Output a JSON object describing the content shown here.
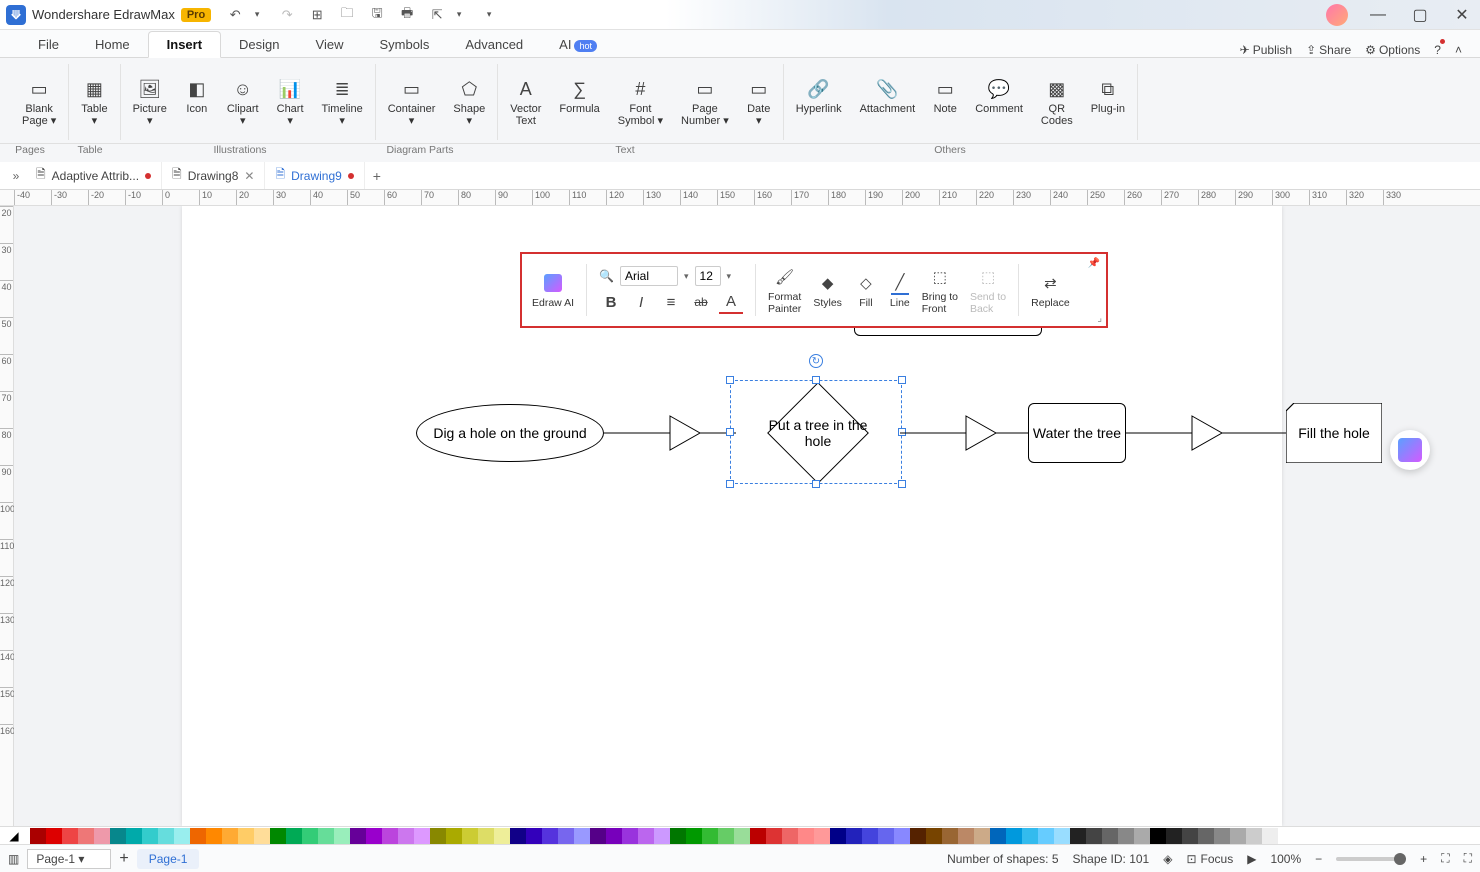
{
  "app": {
    "title": "Wondershare EdrawMax",
    "badge": "Pro"
  },
  "title_actions": [
    "undo",
    "redo",
    "new",
    "open",
    "save",
    "print",
    "export",
    "more"
  ],
  "menu": {
    "tabs": [
      "File",
      "Home",
      "Insert",
      "Design",
      "View",
      "Symbols",
      "Advanced",
      "AI"
    ],
    "active": "Insert",
    "ai_badge": "hot",
    "right": [
      {
        "icon": "↗",
        "label": "Publish"
      },
      {
        "icon": "↪",
        "label": "Share"
      },
      {
        "icon": "⚙",
        "label": "Options"
      },
      {
        "icon": "?",
        "label": ""
      },
      {
        "icon": "˄",
        "label": ""
      }
    ]
  },
  "ribbon": {
    "groups": [
      {
        "title": "Pages",
        "buttons": [
          {
            "icon": "▭",
            "label": "Blank\nPage ▾"
          }
        ]
      },
      {
        "title": "Table",
        "buttons": [
          {
            "icon": "▦",
            "label": "Table\n▾"
          }
        ]
      },
      {
        "title": "Illustrations",
        "buttons": [
          {
            "icon": "🖼",
            "label": "Picture\n▾"
          },
          {
            "icon": "◧",
            "label": "Icon"
          },
          {
            "icon": "☺",
            "label": "Clipart\n▾"
          },
          {
            "icon": "📊",
            "label": "Chart\n▾"
          },
          {
            "icon": "≣",
            "label": "Timeline\n▾"
          }
        ]
      },
      {
        "title": "Diagram Parts",
        "buttons": [
          {
            "icon": "▭",
            "label": "Container\n▾"
          },
          {
            "icon": "⬠",
            "label": "Shape\n▾"
          }
        ]
      },
      {
        "title": "Text",
        "buttons": [
          {
            "icon": "A",
            "label": "Vector\nText"
          },
          {
            "icon": "∑",
            "label": "Formula"
          },
          {
            "icon": "#",
            "label": "Font\nSymbol ▾"
          },
          {
            "icon": "▭",
            "label": "Page\nNumber ▾"
          },
          {
            "icon": "▭",
            "label": "Date\n▾"
          }
        ]
      },
      {
        "title": "Others",
        "buttons": [
          {
            "icon": "🔗",
            "label": "Hyperlink"
          },
          {
            "icon": "📎",
            "label": "Attachment"
          },
          {
            "icon": "▭",
            "label": "Note"
          },
          {
            "icon": "💬",
            "label": "Comment"
          },
          {
            "icon": "▩",
            "label": "QR\nCodes"
          },
          {
            "icon": "⧉",
            "label": "Plug-in"
          }
        ]
      }
    ]
  },
  "doc_tabs": [
    {
      "icon": "📄",
      "label": "Adaptive Attrib...",
      "dot": "#d43030",
      "close": false
    },
    {
      "icon": "📄",
      "label": "Drawing8",
      "dot": null,
      "close": true
    },
    {
      "icon": "📄",
      "label": "Drawing9",
      "dot": "#d43030",
      "close": false,
      "active": true
    }
  ],
  "ruler_h": [
    "-40",
    "-30",
    "-20",
    "-10",
    "0",
    "10",
    "20",
    "30",
    "40",
    "50",
    "60",
    "70",
    "80",
    "90",
    "100",
    "110",
    "120",
    "130",
    "140",
    "150",
    "160",
    "170",
    "180",
    "190",
    "200",
    "210",
    "220",
    "230",
    "240",
    "250",
    "260",
    "270",
    "280",
    "290",
    "300",
    "310",
    "320",
    "330"
  ],
  "ruler_v": [
    "20",
    "30",
    "40",
    "50",
    "60",
    "70",
    "80",
    "90",
    "100",
    "110",
    "120",
    "130",
    "140",
    "150",
    "160"
  ],
  "float_toolbar": {
    "ai_label": "Edraw AI",
    "font_name": "Arial",
    "font_size": "12",
    "format_buttons": [
      "B",
      "I",
      "≡",
      "ab",
      "A"
    ],
    "actions": [
      {
        "icon": "🖌",
        "label": "Format\nPainter"
      },
      {
        "icon": "◆",
        "label": "Styles"
      },
      {
        "icon": "◇",
        "label": "Fill"
      },
      {
        "icon": "/",
        "label": "Line"
      },
      {
        "icon": "⤡",
        "label": "Bring to\nFront"
      },
      {
        "icon": "⤢",
        "label": "Send to\nBack",
        "disabled": true
      },
      {
        "icon": "⇄",
        "label": "Replace"
      }
    ]
  },
  "shapes": {
    "ellipse": "Dig a hole on the ground",
    "diamond": "Put a tree in the hole",
    "rect": "Water the tree",
    "doc": "Fill the hole"
  },
  "colors": [
    "#a00",
    "#d00",
    "#e44",
    "#e77",
    "#e9a",
    "#07878c",
    "#0aa",
    "#3cc",
    "#6dd",
    "#9ee",
    "#e60",
    "#f80",
    "#fa3",
    "#fc6",
    "#fd9",
    "#080",
    "#0a5",
    "#3c7",
    "#6d9",
    "#9eb",
    "#609",
    "#90c",
    "#b4d",
    "#c7e",
    "#d9f",
    "#880",
    "#aa0",
    "#cc3",
    "#dd6",
    "#ee9",
    "#108",
    "#30b",
    "#53d",
    "#76e",
    "#99f",
    "#508",
    "#70b",
    "#93d",
    "#b6e",
    "#c9f",
    "#070",
    "#090",
    "#3b3",
    "#6c6",
    "#9d9",
    "#b00",
    "#d33",
    "#e66",
    "#f88",
    "#f99",
    "#008",
    "#22b",
    "#44d",
    "#66e",
    "#88f",
    "#520",
    "#740",
    "#963",
    "#b86",
    "#ca8",
    "#06b",
    "#09d",
    "#3be",
    "#6cf",
    "#9df",
    "#222",
    "#444",
    "#666",
    "#888",
    "#aaa",
    "#000",
    "#222",
    "#444",
    "#666",
    "#888",
    "#aaa",
    "#ccc",
    "#eee",
    "#fff"
  ],
  "status": {
    "page_select": "Page-1",
    "page_tab": "Page-1",
    "shapes_count": "Number of shapes: 5",
    "shape_id": "Shape ID: 101",
    "focus": "Focus",
    "zoom": "100%"
  }
}
